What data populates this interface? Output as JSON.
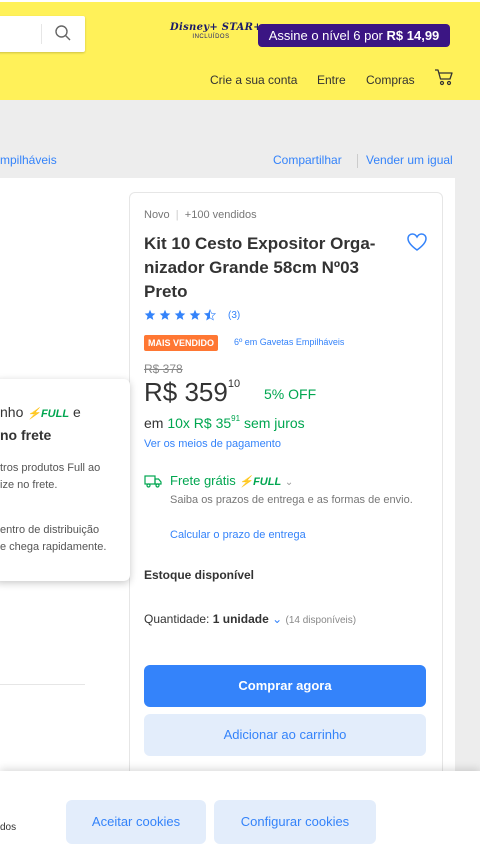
{
  "header": {
    "search_placeholder": "",
    "disney_logo_text": "Disney+ STAR+",
    "disney_logo_sub": "INCLUÍDOS",
    "subscription_banner_prefix": "Assine o nível 6 por",
    "subscription_banner_price": "R$ 14,99",
    "nav": {
      "create_account": "Crie a sua conta",
      "login": "Entre",
      "purchases": "Compras"
    },
    "colors": {
      "header_bg": "#fff159",
      "banner_bg": "#3b1583"
    }
  },
  "breadcrumb_tail": "mpilháveis",
  "actions": {
    "share": "Compartilhar",
    "sell_same": "Vender um igual"
  },
  "full_tooltip": {
    "title_line1_prefix": "nho",
    "full_label": "FULL",
    "title_line1_suffix": "e",
    "title_line2": "no frete",
    "text_lines": [
      "tros produtos Full ao",
      "ize no frete.",
      "entro de distribuição",
      "e chega rapidamente."
    ]
  },
  "product": {
    "condition": "Novo",
    "sold": "+100 vendidos",
    "title": "Kit 10 Cesto Expositor Orga-nizador Grande 58cm Nº03 Preto",
    "rating": 4.5,
    "rating_count": "(3)",
    "badge": "MAIS VENDIDO",
    "rank": "6º em Gavetas Empilháveis",
    "old_price": "R$ 378",
    "price_int": "R$ 359",
    "price_cents": "10",
    "discount": "5% OFF",
    "installments_prefix": "em",
    "installments_value": "10x R$ 35",
    "installments_cents": "91",
    "installments_suffix": "sem juros",
    "payment_link": "Ver os meios de pagamento",
    "shipping_free": "Frete grátis",
    "shipping_full": "FULL",
    "shipping_desc": "Saiba os prazos de entrega e as formas de envio.",
    "calc_link": "Calcular o prazo de entrega",
    "stock": "Estoque disponível",
    "qty_label": "Quantidade:",
    "qty_value": "1 unidade",
    "qty_available": "(14 disponíveis)",
    "buy_now": "Comprar agora",
    "add_to_cart": "Adicionar ao carrinho",
    "colors": {
      "accent": "#3483fa",
      "green": "#00a650",
      "badge": "#ff7733"
    }
  },
  "cookies": {
    "text_fragment": "dos",
    "accept": "Aceitar cookies",
    "configure": "Configurar cookies"
  }
}
